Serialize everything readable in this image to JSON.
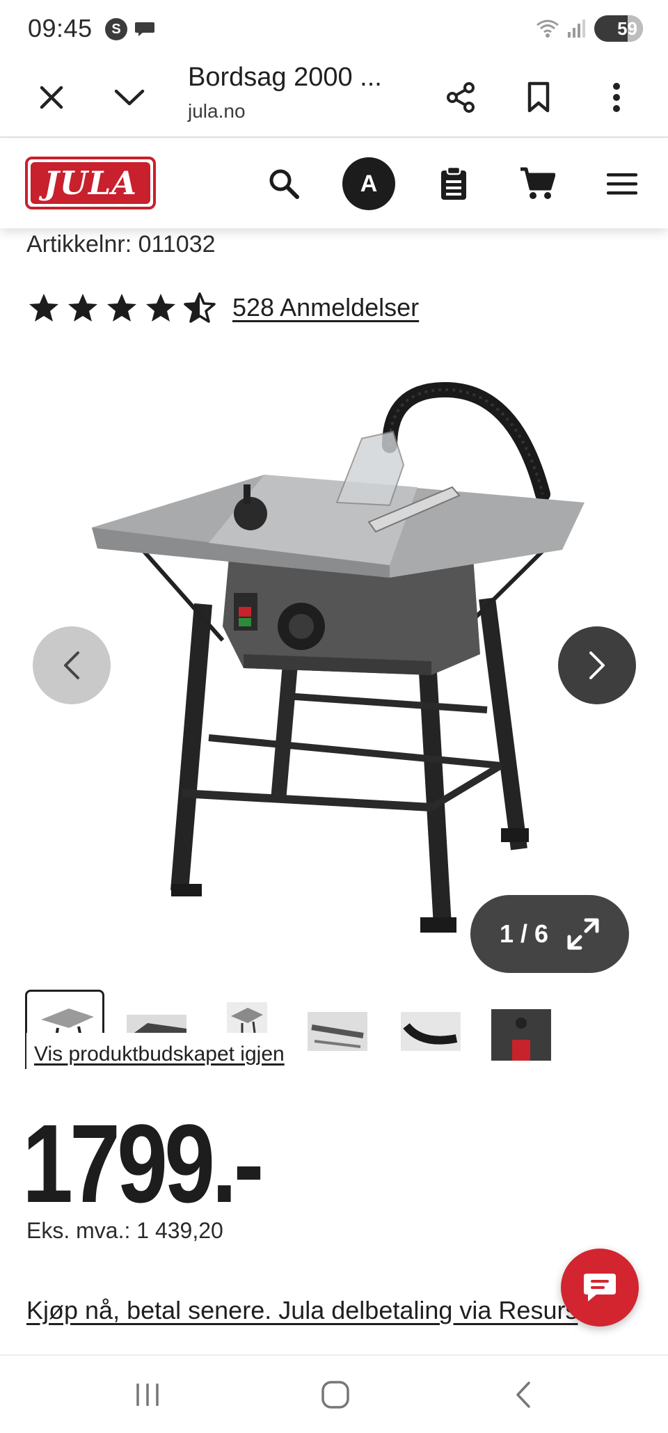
{
  "status_bar": {
    "time": "09:45",
    "battery": "59"
  },
  "browser": {
    "title": "Bordsag 2000 ...",
    "url": "jula.no"
  },
  "site_header": {
    "logo_text": "JULA",
    "avatar_initial": "A"
  },
  "product": {
    "article_number": "Artikkelnr: 011032",
    "rating_stars": 4.5,
    "reviews_label": "528 Anmeldelser",
    "gallery_counter": "1 / 6",
    "show_box_link": "Vis produktbudskapet igjen",
    "price": "1799.-",
    "vat_text": "Eks. mva.: 1 439,20",
    "finance_link": "Kjøp nå, betal senere. Jula delbetaling via Resurs"
  },
  "colors": {
    "brand_red": "#c8202c",
    "fab_red": "#d3252f"
  }
}
